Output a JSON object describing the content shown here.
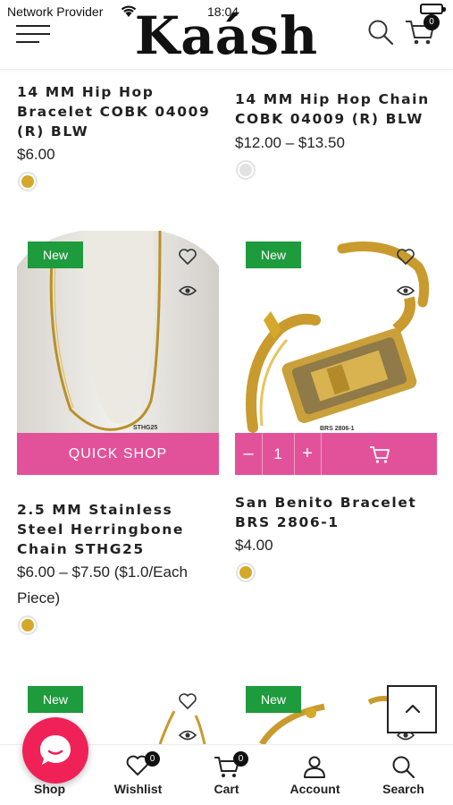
{
  "status_bar": {
    "carrier": "Network Provider",
    "time": "18:04"
  },
  "header": {
    "logo": "Kaásh",
    "cart_count": "0",
    "icons": [
      "hamburger-menu-icon",
      "search-icon",
      "cart-icon"
    ]
  },
  "products_top": [
    {
      "title_lines": [
        "14 MM Hip Hop",
        "Bracelet COBK 04009",
        "(R) BLW"
      ],
      "price": "$6.00",
      "swatch_color": "#D4A82A"
    },
    {
      "title_lines": [
        "14 MM Hip Hop Chain",
        "COBK 04009 (R) BLW"
      ],
      "price": "$12.00 – $13.50",
      "swatch_color": "#E2E2E2"
    }
  ],
  "products_mid": [
    {
      "badge": "New",
      "action_label": "QUICK SHOP",
      "image_label": "STHG25",
      "title_lines": [
        "2.5 MM Stainless",
        "Steel Herringbone",
        "Chain STHG25"
      ],
      "price_lines": [
        "$6.00 – $7.50 ($1.0/Each",
        "Piece)"
      ],
      "swatch_color": "#D4A82A"
    },
    {
      "badge": "New",
      "qty_minus": "–",
      "qty_value": "1",
      "qty_plus": "+",
      "image_label": "BRS 2806-1",
      "title_lines": [
        "San Benito Bracelet",
        "BRS 2806-1"
      ],
      "price": "$4.00",
      "swatch_color": "#D4A82A"
    }
  ],
  "products_bottom": [
    {
      "badge": "New"
    },
    {
      "badge": "New"
    }
  ],
  "bottom_nav": {
    "items": [
      {
        "label": "Shop",
        "icon": "chat-icon"
      },
      {
        "label": "Wishlist",
        "icon": "heart-icon",
        "badge": "0"
      },
      {
        "label": "Cart",
        "icon": "cart-icon",
        "badge": "0"
      },
      {
        "label": "Account",
        "icon": "user-icon"
      },
      {
        "label": "Search",
        "icon": "search-icon"
      }
    ]
  },
  "colors": {
    "accent_pink": "#E2529A",
    "badge_green": "#1E9B3C",
    "chat_red": "#EF2157",
    "gold": "#D4A82A"
  }
}
